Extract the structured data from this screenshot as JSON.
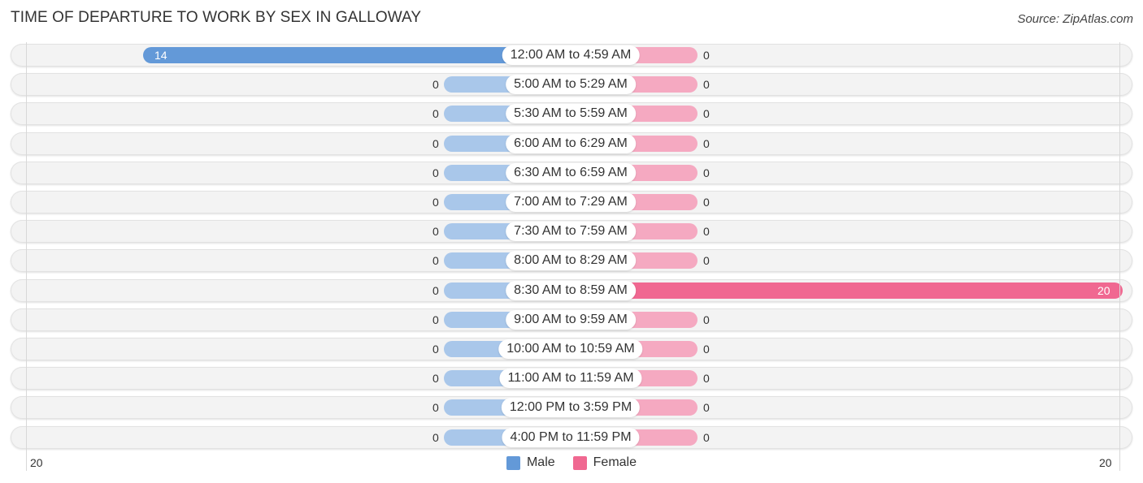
{
  "title": "TIME OF DEPARTURE TO WORK BY SEX IN GALLOWAY",
  "source": "Source: ZipAtlas.com",
  "colors": {
    "male": "#6399d8",
    "male_light": "#a9c7ea",
    "female": "#f06891",
    "female_light": "#f5a9c1"
  },
  "chart_data": {
    "type": "bar",
    "orientation": "horizontal-diverging",
    "title": "TIME OF DEPARTURE TO WORK BY SEX IN GALLOWAY",
    "categories": [
      "12:00 AM to 4:59 AM",
      "5:00 AM to 5:29 AM",
      "5:30 AM to 5:59 AM",
      "6:00 AM to 6:29 AM",
      "6:30 AM to 6:59 AM",
      "7:00 AM to 7:29 AM",
      "7:30 AM to 7:59 AM",
      "8:00 AM to 8:29 AM",
      "8:30 AM to 8:59 AM",
      "9:00 AM to 9:59 AM",
      "10:00 AM to 10:59 AM",
      "11:00 AM to 11:59 AM",
      "12:00 PM to 3:59 PM",
      "4:00 PM to 11:59 PM"
    ],
    "series": [
      {
        "name": "Male",
        "values": [
          14,
          0,
          0,
          0,
          0,
          0,
          0,
          0,
          0,
          0,
          0,
          0,
          0,
          0
        ]
      },
      {
        "name": "Female",
        "values": [
          0,
          0,
          0,
          0,
          0,
          0,
          0,
          0,
          20,
          0,
          0,
          0,
          0,
          0
        ]
      }
    ],
    "xlim": [
      -20,
      20
    ],
    "axis_ticks": {
      "left": "20",
      "right": "20"
    },
    "legend": {
      "position": "bottom-center",
      "entries": [
        "Male",
        "Female"
      ]
    },
    "grid": false
  }
}
